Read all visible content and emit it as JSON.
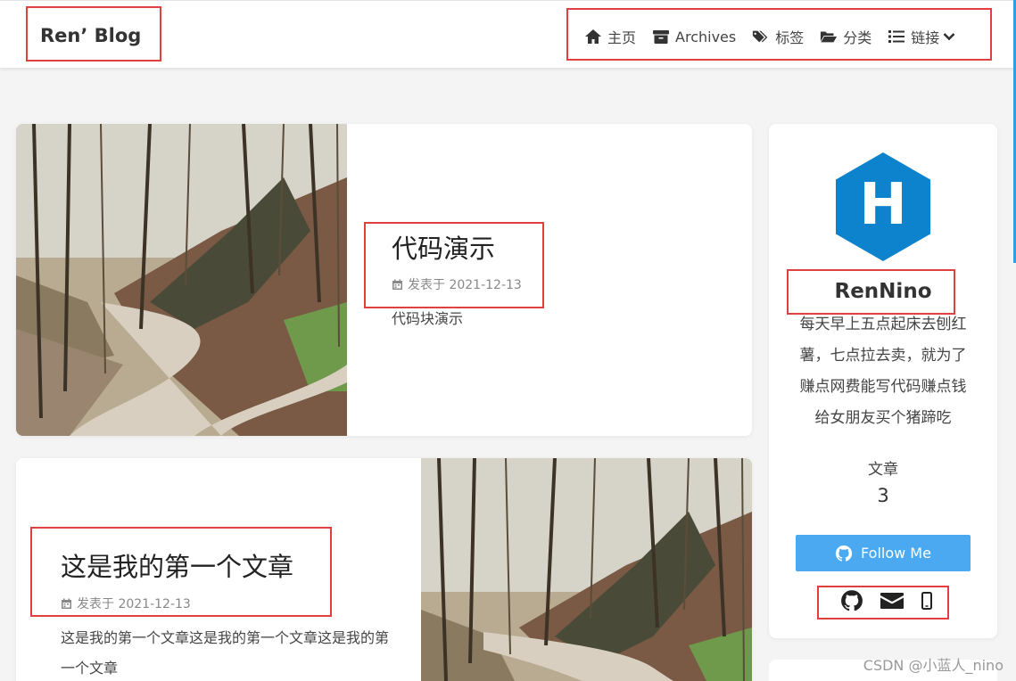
{
  "brand": "Ren’ Blog",
  "nav": {
    "home": "主页",
    "archives": "Archives",
    "tags": "标签",
    "categories": "分类",
    "links": "链接"
  },
  "posts": [
    {
      "title": "代码演示",
      "meta": "发表于 2021-12-13",
      "excerpt": "代码块演示"
    },
    {
      "title": "这是我的第一个文章",
      "meta": "发表于 2021-12-13",
      "excerpt": "这是我的第一个文章这是我的第一个文章这是我的第一个文章"
    }
  ],
  "author": {
    "logo_letter": "H",
    "name": "RenNino",
    "bio": "每天早上五点起床去刨红薯，七点拉去卖，就为了赚点网费能写代码赚点钱给女朋友买个猪蹄吃",
    "posts_label": "文章",
    "posts_count": "3",
    "follow_label": "Follow Me"
  },
  "social_icons": [
    "github-icon",
    "envelope-icon",
    "mobile-icon"
  ],
  "watermark": "CSDN @小蓝人_nino",
  "colors": {
    "accent_blue": "#4aa9f0",
    "hexo_blue": "#0e83cd",
    "highlight_red": "#e0403f"
  }
}
